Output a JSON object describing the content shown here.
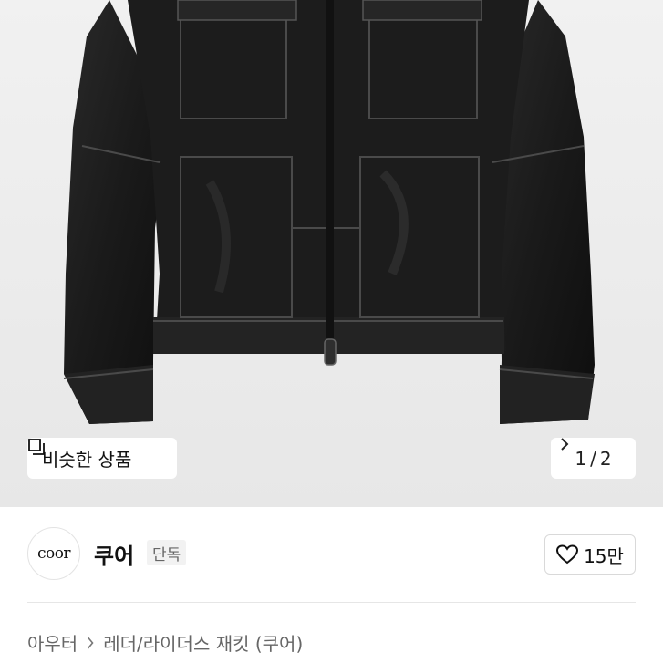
{
  "product_image": {
    "alt_icon": "leather-jacket-photo",
    "bg_color": "#ececec"
  },
  "similar_button": {
    "icon": "copy-squares-icon",
    "label": "비슷한 상품"
  },
  "pager": {
    "current": "1",
    "separator": "/",
    "total": "2",
    "icon": "chevron-right-icon"
  },
  "brand": {
    "logo_text": "coor",
    "name": "쿠어",
    "badge": "단독"
  },
  "like": {
    "icon": "heart-outline-icon",
    "count": "15만"
  },
  "breadcrumb": {
    "items": [
      "아우터",
      "레더/라이더스 재킷 (쿠어)"
    ],
    "separator_icon": "chevron-right-icon"
  }
}
